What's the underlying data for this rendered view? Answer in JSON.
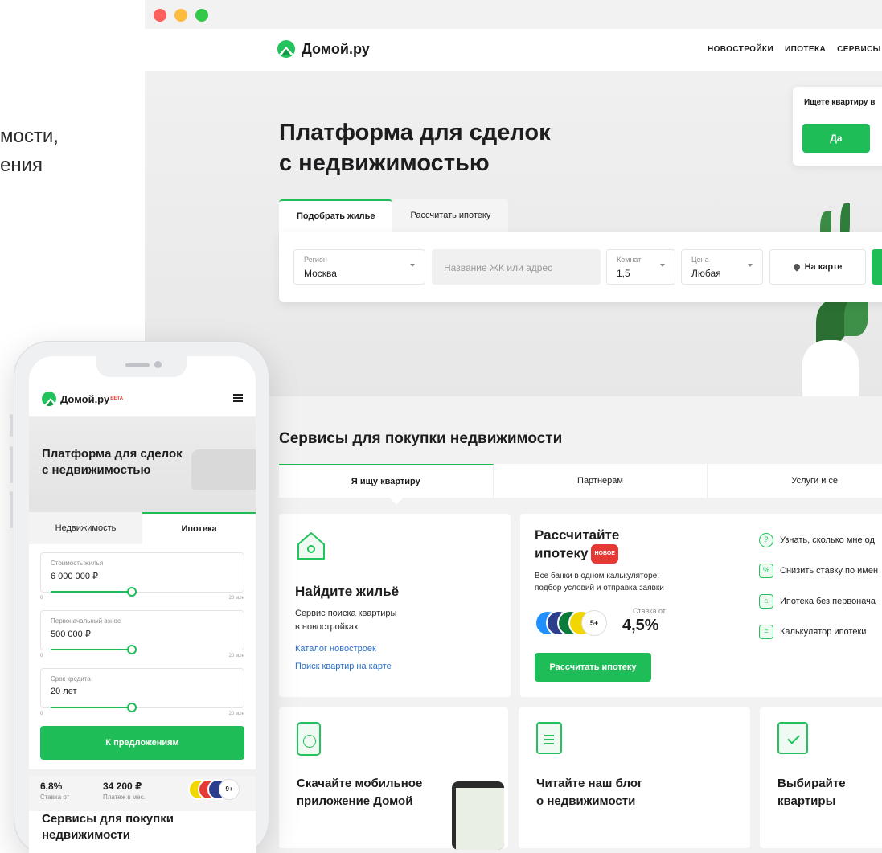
{
  "left_fragment": {
    "line1": "мости,",
    "line2": "ения"
  },
  "desktop": {
    "logo_text": "Домой.ру",
    "nav": [
      "НОВОСТРОЙКИ",
      "ИПОТЕКА",
      "СЕРВИСЫ"
    ],
    "hero": {
      "title_line1": "Платформа для сделок",
      "title_line2": "с недвижимостью"
    },
    "popup": {
      "question": "Ищете квартиру в",
      "yes_label": "Да"
    },
    "search": {
      "tabs": [
        "Подобрать жилье",
        "Рассчитать ипотеку"
      ],
      "region_label": "Регион",
      "region_value": "Москва",
      "address_placeholder": "Название ЖК или адрес",
      "rooms_label": "Комнат",
      "rooms_value": "1,5",
      "price_label": "Цена",
      "price_value": "Любая",
      "map_label": "На карте"
    },
    "services": {
      "title": "Сервисы для покупки недвижимости",
      "tabs": [
        "Я ищу квартиру",
        "Партнерам",
        "Услуги и се"
      ],
      "find": {
        "title": "Найдите жильё",
        "desc_line1": "Сервис поиска квартиры",
        "desc_line2": "в новостройках",
        "link1": "Каталог новостроек",
        "link2": "Поиск квартир на карте"
      },
      "mortgage": {
        "title_line1": "Рассчитайте",
        "title_line2": "ипотеку",
        "badge": "НОВОЕ",
        "desc_line1": "Все банки в одном калькуляторе,",
        "desc_line2": "подбор условий и отправка заявки",
        "banks_more": "5+",
        "rate_label": "Ставка от",
        "rate_value": "4,5%",
        "button": "Рассчитать ипотеку",
        "links": [
          "Узнать, сколько мне од",
          "Снизить ставку по имен",
          "Ипотека без первонача",
          "Калькулятор ипотеки"
        ],
        "link_icons": [
          "question-icon",
          "percent-icon",
          "home-icon",
          "calculator-icon"
        ]
      },
      "app": {
        "line1": "Скачайте мобильное",
        "line2": "приложение Домой"
      },
      "blog": {
        "line1": "Читайте наш блог",
        "line2": "о недвижимости"
      },
      "choose": {
        "line1": "Выбирайте",
        "line2": "квартиры"
      }
    }
  },
  "mobile": {
    "logo_text": "Домой.ру",
    "beta": "BETA",
    "hero_line1": "Платформа для сделок",
    "hero_line2": "с недвижимостью",
    "tabs": [
      "Недвижимость",
      "Ипотека"
    ],
    "fields": [
      {
        "label": "Стоимость жилья",
        "value": "6 000 000 ₽",
        "min": "0",
        "max": "20 млн",
        "level": 0.42
      },
      {
        "label": "Первоначальный взнос",
        "value": "500 000 ₽",
        "min": "0",
        "max": "20 млн",
        "level": 0.42
      },
      {
        "label": "Срок кредита",
        "value": "20 лет",
        "min": "0",
        "max": "20 млн",
        "level": 0.42
      }
    ],
    "cta": "К предложениям",
    "stat1_value": "6,8%",
    "stat1_label": "Ставка от",
    "stat2_value": "34 200 ₽",
    "stat2_label": "Платеж в мес.",
    "banks_more": "9+",
    "services_line1": "Сервисы для покупки",
    "services_line2": "недвижимости"
  },
  "colors": {
    "accent": "#1fbd58",
    "badge": "#e53935",
    "link": "#2a6fc7"
  }
}
